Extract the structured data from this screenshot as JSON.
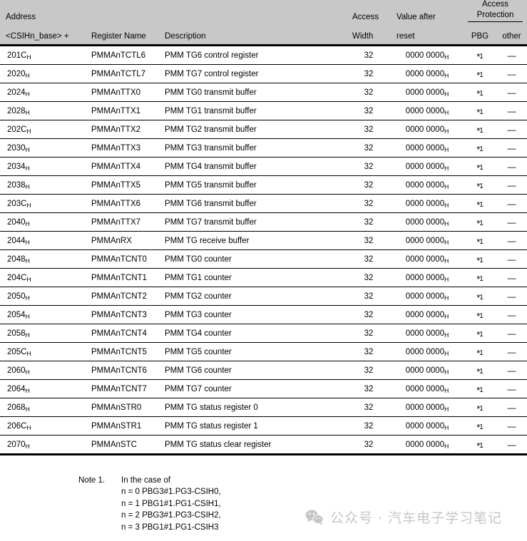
{
  "table": {
    "headers": {
      "address_line1": "Address",
      "address_line2": "<CSIHn_base> +",
      "register_name": "Register Name",
      "description": "Description",
      "access_width_line1": "Access",
      "access_width_line2": "Width",
      "value_after_reset_line1": "Value after",
      "value_after_reset_line2": "reset",
      "access_protection_line1": "Access",
      "access_protection_line2": "Protection",
      "pbg": "PBG",
      "other": "other"
    },
    "rows": [
      {
        "address": "201C",
        "address_sub": "H",
        "name": "PMMAnTCTL6",
        "description": "PMM TG6 control register",
        "width": "32",
        "value": "0000 0000",
        "value_sub": "H",
        "pbg": "1",
        "other": "—"
      },
      {
        "address": "2020",
        "address_sub": "H",
        "name": "PMMAnTCTL7",
        "description": "PMM TG7 control register",
        "width": "32",
        "value": "0000 0000",
        "value_sub": "H",
        "pbg": "1",
        "other": "—"
      },
      {
        "address": "2024",
        "address_sub": "H",
        "name": "PMMAnTTX0",
        "description": "PMM TG0 transmit buffer",
        "width": "32",
        "value": "0000 0000",
        "value_sub": "H",
        "pbg": "1",
        "other": "—"
      },
      {
        "address": "2028",
        "address_sub": "H",
        "name": "PMMAnTTX1",
        "description": "PMM TG1 transmit buffer",
        "width": "32",
        "value": "0000 0000",
        "value_sub": "H",
        "pbg": "1",
        "other": "—"
      },
      {
        "address": "202C",
        "address_sub": "H",
        "name": "PMMAnTTX2",
        "description": "PMM TG2 transmit buffer",
        "width": "32",
        "value": "0000 0000",
        "value_sub": "H",
        "pbg": "1",
        "other": "—"
      },
      {
        "address": "2030",
        "address_sub": "H",
        "name": "PMMAnTTX3",
        "description": "PMM TG3 transmit buffer",
        "width": "32",
        "value": "0000 0000",
        "value_sub": "H",
        "pbg": "1",
        "other": "—"
      },
      {
        "address": "2034",
        "address_sub": "H",
        "name": "PMMAnTTX4",
        "description": "PMM TG4 transmit buffer",
        "width": "32",
        "value": "0000 0000",
        "value_sub": "H",
        "pbg": "1",
        "other": "—"
      },
      {
        "address": "2038",
        "address_sub": "H",
        "name": "PMMAnTTX5",
        "description": "PMM TG5 transmit buffer",
        "width": "32",
        "value": "0000 0000",
        "value_sub": "H",
        "pbg": "1",
        "other": "—"
      },
      {
        "address": "203C",
        "address_sub": "H",
        "name": "PMMAnTTX6",
        "description": "PMM TG6 transmit buffer",
        "width": "32",
        "value": "0000 0000",
        "value_sub": "H",
        "pbg": "1",
        "other": "—"
      },
      {
        "address": "2040",
        "address_sub": "H",
        "name": "PMMAnTTX7",
        "description": "PMM TG7 transmit buffer",
        "width": "32",
        "value": "0000 0000",
        "value_sub": "H",
        "pbg": "1",
        "other": "—"
      },
      {
        "address": "2044",
        "address_sub": "H",
        "name": "PMMAnRX",
        "description": "PMM TG receive buffer",
        "width": "32",
        "value": "0000 0000",
        "value_sub": "H",
        "pbg": "1",
        "other": "—"
      },
      {
        "address": "2048",
        "address_sub": "H",
        "name": "PMMAnTCNT0",
        "description": "PMM TG0 counter",
        "width": "32",
        "value": "0000 0000",
        "value_sub": "H",
        "pbg": "1",
        "other": "—"
      },
      {
        "address": "204C",
        "address_sub": "H",
        "name": "PMMAnTCNT1",
        "description": "PMM TG1 counter",
        "width": "32",
        "value": "0000 0000",
        "value_sub": "H",
        "pbg": "1",
        "other": "—"
      },
      {
        "address": "2050",
        "address_sub": "H",
        "name": "PMMAnTCNT2",
        "description": "PMM TG2 counter",
        "width": "32",
        "value": "0000 0000",
        "value_sub": "H",
        "pbg": "1",
        "other": "—"
      },
      {
        "address": "2054",
        "address_sub": "H",
        "name": "PMMAnTCNT3",
        "description": "PMM TG3 counter",
        "width": "32",
        "value": "0000 0000",
        "value_sub": "H",
        "pbg": "1",
        "other": "—"
      },
      {
        "address": "2058",
        "address_sub": "H",
        "name": "PMMAnTCNT4",
        "description": "PMM TG4 counter",
        "width": "32",
        "value": "0000 0000",
        "value_sub": "H",
        "pbg": "1",
        "other": "—"
      },
      {
        "address": "205C",
        "address_sub": "H",
        "name": "PMMAnTCNT5",
        "description": "PMM TG5 counter",
        "width": "32",
        "value": "0000 0000",
        "value_sub": "H",
        "pbg": "1",
        "other": "—"
      },
      {
        "address": "2060",
        "address_sub": "H",
        "name": "PMMAnTCNT6",
        "description": "PMM TG6 counter",
        "width": "32",
        "value": "0000 0000",
        "value_sub": "H",
        "pbg": "1",
        "other": "—"
      },
      {
        "address": "2064",
        "address_sub": "H",
        "name": "PMMAnTCNT7",
        "description": "PMM TG7 counter",
        "width": "32",
        "value": "0000 0000",
        "value_sub": "H",
        "pbg": "1",
        "other": "—"
      },
      {
        "address": "2068",
        "address_sub": "H",
        "name": "PMMAnSTR0",
        "description": "PMM TG status register 0",
        "width": "32",
        "value": "0000 0000",
        "value_sub": "H",
        "pbg": "1",
        "other": "—"
      },
      {
        "address": "206C",
        "address_sub": "H",
        "name": "PMMAnSTR1",
        "description": "PMM TG status register 1",
        "width": "32",
        "value": "0000 0000",
        "value_sub": "H",
        "pbg": "1",
        "other": "—"
      },
      {
        "address": "2070",
        "address_sub": "H",
        "name": "PMMAnSTC",
        "description": "PMM TG status clear register",
        "width": "32",
        "value": "0000 0000",
        "value_sub": "H",
        "pbg": "1",
        "other": "—"
      }
    ]
  },
  "note": {
    "label": "Note 1.",
    "intro": "In the case of",
    "lines": [
      "n = 0 PBG3#1.PG3-CSIH0,",
      "n = 1 PBG1#1.PG1-CSIH1,",
      "n = 2 PBG3#1.PG3-CSIH2,",
      "n = 3 PBG1#1.PG1-CSIH3"
    ]
  },
  "watermark": {
    "icon": "wechat-icon",
    "text": "公众号 · 汽车电子学习笔记",
    "color": "#c6c6c6"
  },
  "colors": {
    "header_background": "#c8c8c8",
    "rule": "#000000",
    "page_background": "#ffffff"
  }
}
